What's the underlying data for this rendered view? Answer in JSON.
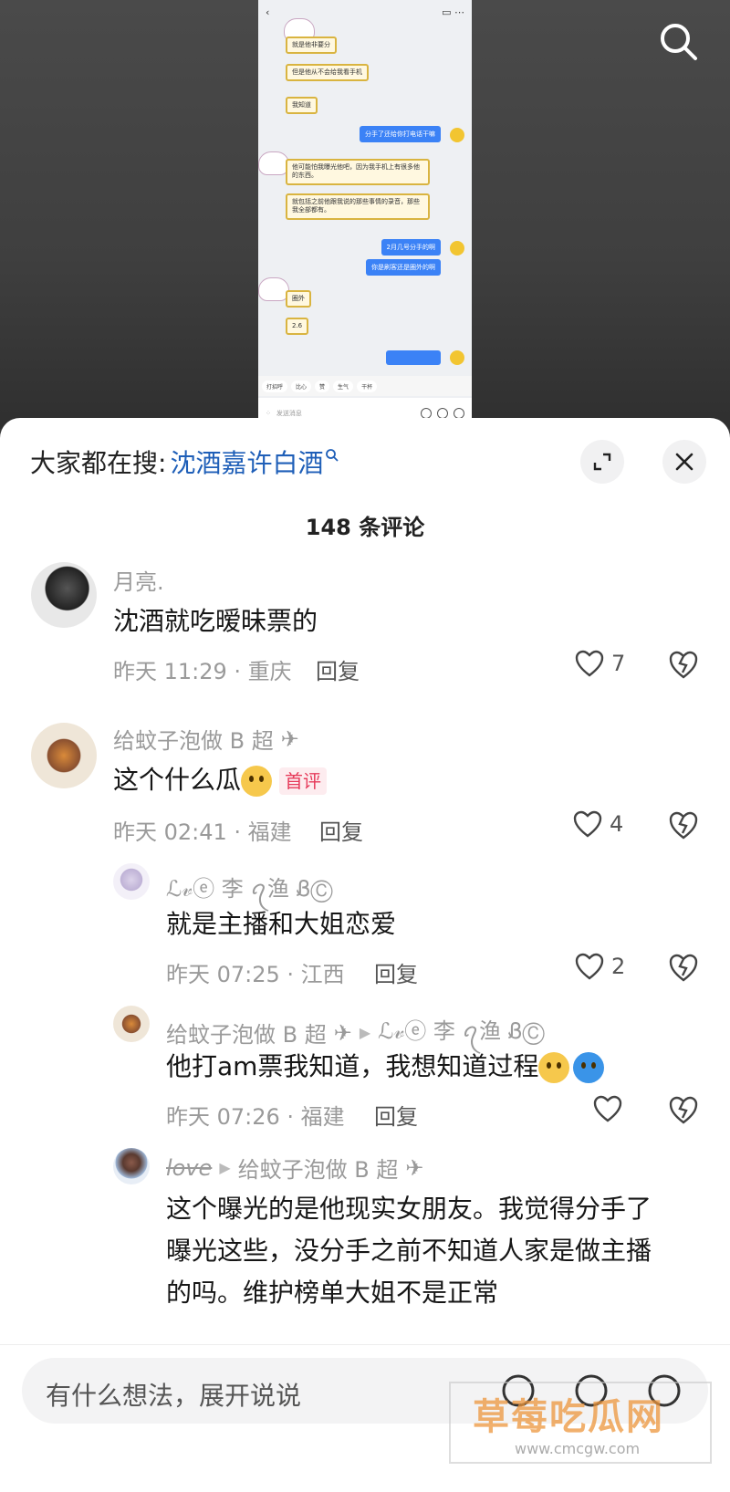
{
  "video": {
    "chat_messages": [
      {
        "side": "left",
        "text": "就是他非要分"
      },
      {
        "side": "left",
        "text": "但是他从不会给我看手机"
      },
      {
        "side": "left",
        "text": "我知道"
      },
      {
        "side": "right",
        "text": "分手了还给你打电话干嘛"
      },
      {
        "side": "left",
        "text": "他可能怕我曝光他吧，因为我手机上有很多他的东西。"
      },
      {
        "side": "left",
        "text": "就包括之前他跟我说的那些事情的录音，那些我全部都有。"
      },
      {
        "side": "right",
        "text": "2月几号分手的啊"
      },
      {
        "side": "right",
        "text": "你是刷客还是圈外的啊"
      },
      {
        "side": "left",
        "text": "圈外"
      },
      {
        "side": "left",
        "text": "2.6"
      }
    ],
    "chat_tools": [
      "打招呼",
      "比心",
      "赞",
      "生气",
      "干杯"
    ],
    "chat_input_placeholder": "发送消息"
  },
  "sheet": {
    "trending_prefix": "大家都在搜:",
    "trending_keyword": "沈酒嘉许白酒",
    "comment_count": "148 条评论",
    "reply_label": "回复"
  },
  "comments": [
    {
      "user": "月亮.",
      "text": "沈酒就吃暧昧票的",
      "time": "昨天 11:29 · 重庆",
      "likes": "7"
    },
    {
      "user": "给蚊子泡做 B 超",
      "text": "这个什么瓜",
      "badge": "首评",
      "time": "昨天 02:41 · 福建",
      "likes": "4"
    },
    {
      "user": "ℒ𝓋ⓔ 李 ꪖ渔 ᏰⒸ",
      "text": "就是主播和大姐恋爱",
      "time": "昨天 07:25 · 江西",
      "likes": "2"
    },
    {
      "user": "给蚊子泡做 B 超",
      "reply_to": "ℒ𝓋ⓔ 李 ꪖ渔 ᏰⒸ",
      "text": "他打am票我知道，我想知道过程",
      "time": "昨天 07:26 · 福建",
      "likes": ""
    },
    {
      "user": "love",
      "reply_to": "给蚊子泡做 B 超",
      "text_lines": [
        "这个曝光的是他现实女朋友。我觉得分手了",
        "曝光这些，没分手之前不知道人家是做主播",
        "的吗。维护榜单大姐不是正常"
      ]
    }
  ],
  "input": {
    "placeholder": "有什么想法，展开说说"
  },
  "watermark": {
    "title": "草莓吃瓜网",
    "sub": "www.cmcgw.com"
  },
  "colors": {
    "keyword": "#1f5fb8",
    "badge": "#e63a5a",
    "chat_blue": "#3b82f6",
    "chat_gold": "#d9b440"
  }
}
